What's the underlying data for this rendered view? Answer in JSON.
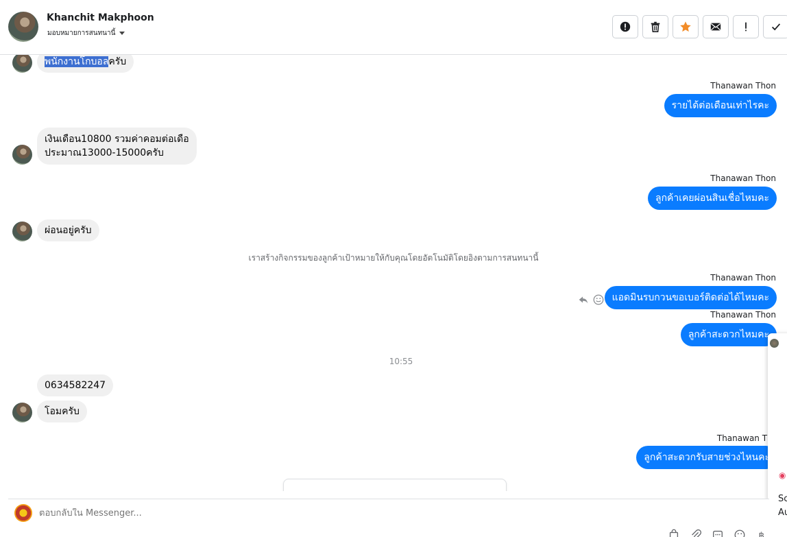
{
  "header": {
    "contact_name": "Khanchit Makphoon",
    "assign_label": "มอบหมายการสนทนานี้"
  },
  "toolbar": [
    {
      "name": "spam-button",
      "icon": "alert-circle-icon"
    },
    {
      "name": "delete-button",
      "icon": "trash-icon"
    },
    {
      "name": "star-button",
      "icon": "star-icon"
    },
    {
      "name": "mark-unread-button",
      "icon": "envelope-icon"
    },
    {
      "name": "follow-up-button",
      "icon": "exclamation-icon"
    },
    {
      "name": "done-button",
      "icon": "check-icon"
    }
  ],
  "messages": {
    "m1_highlight": "พนักงานโกบอล",
    "m1_rest": "ครับ",
    "sender1": "Thanawan Thon",
    "m2": "รายได้ต่อเดือนเท่าไรคะ",
    "m3_line1": "เงินเดือน10800 รวมค่าคอมต่อเดือ",
    "m3_line2": "ประมาณ13000-15000ครับ",
    "sender2": "Thanawan Thon",
    "m4": "ลูกค้าเคยผ่อนสินเชื่อไหมคะ",
    "m5": "ผ่อนอยู่ครับ",
    "system_note": "เราสร้างกิจกรรมของลูกค้าเป้าหมายให้กับคุณโดยอัตโนมัติโดยอิงตามการสนทนานี้",
    "sender3": "Thanawan Thon",
    "m6": "แอดมินรบกวนขอเบอร์ติดต่อได้ไหมคะ",
    "sender4": "Thanawan Thon",
    "m7": "ลูกค้าสะดวกไหมคะ",
    "timestamp": "10:55",
    "m8": "0634582247",
    "m9": "โอมครับ",
    "sender5": "Thanawan Tho",
    "m10": "ลูกค้าสะดวกรับสายช่วงไหนคะ"
  },
  "edge_panel": {
    "text1": "Sc",
    "text2": "Au"
  },
  "composer": {
    "placeholder": "ตอบกลับใน Messenger..."
  },
  "colors": {
    "outgoing_bubble": "#0a7cff",
    "incoming_bubble": "#f0f0f0",
    "star": "#f28c28"
  }
}
